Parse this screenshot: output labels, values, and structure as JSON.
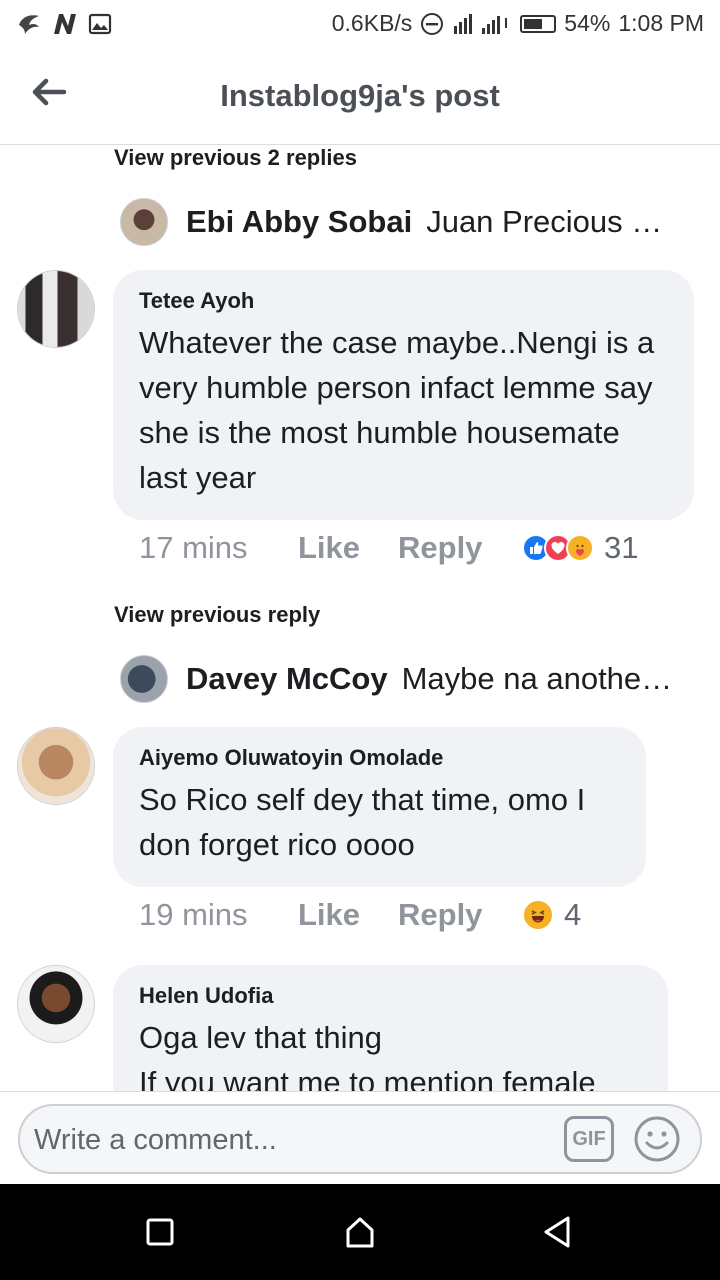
{
  "status_bar": {
    "left_icons": [
      "swallow-icon",
      "n-icon",
      "image-icon"
    ],
    "speed": "0.6KB/s",
    "battery": "54%",
    "time": "1:08 PM"
  },
  "header": {
    "title": "Instablog9ja's post"
  },
  "thread1": {
    "view_previous": "View previous 2 replies",
    "reply_name": "Ebi Abby Sobai",
    "reply_text": "Juan Precious Oil..."
  },
  "comments": [
    {
      "name": "Tetee Ayoh",
      "text": "Whatever the case maybe..Nengi is a very humble person infact lemme say she is the most humble housemate last year",
      "time": "17 mins",
      "like": "Like",
      "reply": "Reply",
      "reactions": [
        "like-reaction-icon",
        "love-reaction-icon",
        "care-reaction-icon"
      ],
      "reaction_count": "31"
    },
    {
      "name": "Aiyemo Oluwatoyin Omolade",
      "text": "So Rico self dey that time, omo I don forget rico oooo",
      "time": "19 mins",
      "like": "Like",
      "reply": "Reply",
      "reactions": [
        "haha-reaction-icon"
      ],
      "reaction_count": "4"
    },
    {
      "name": "Helen Udofia",
      "text": "Oga lev that thing\nIf you want me to mention female"
    }
  ],
  "thread2": {
    "view_previous": "View previous reply",
    "reply_name": "Davey McCoy",
    "reply_text": "Maybe na another person"
  },
  "composer": {
    "placeholder": "Write a comment...",
    "gif_label": "GIF"
  },
  "colors": {
    "bubble": "#f0f2f5",
    "meta": "#90949c",
    "like_blue": "#1877f2",
    "love_red": "#f33e58"
  }
}
